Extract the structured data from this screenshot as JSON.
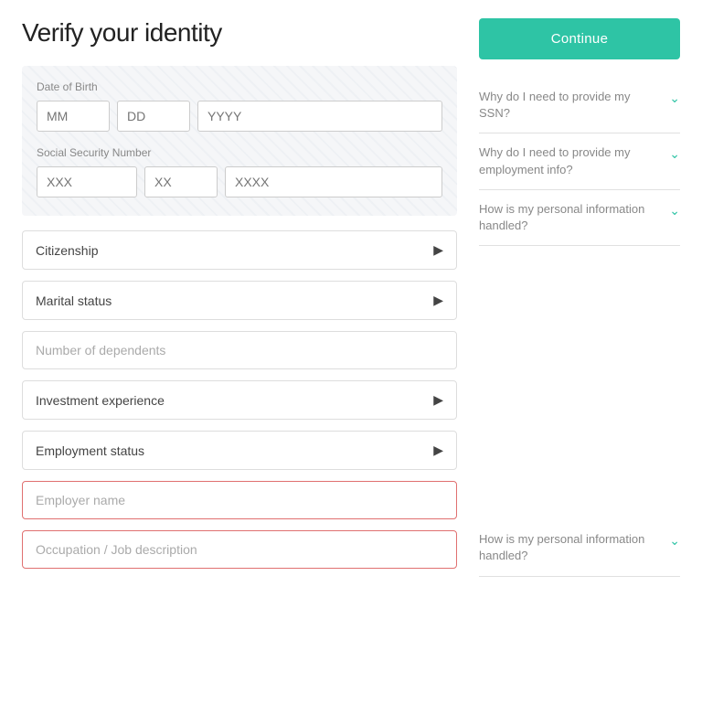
{
  "header": {
    "title": "Verify your identity"
  },
  "form": {
    "dob_label": "Date of Birth",
    "dob_mm_placeholder": "MM",
    "dob_dd_placeholder": "DD",
    "dob_yyyy_placeholder": "YYYY",
    "ssn_label": "Social Security Number",
    "ssn_p1_placeholder": "XXX",
    "ssn_p2_placeholder": "XX",
    "ssn_p3_placeholder": "XXXX",
    "citizenship_label": "Citizenship",
    "marital_label": "Marital status",
    "dependents_placeholder": "Number of dependents",
    "investment_label": "Investment experience",
    "employment_label": "Employment status",
    "employer_placeholder": "Employer name",
    "occupation_placeholder": "Occupation / Job description"
  },
  "sidebar": {
    "continue_label": "Continue",
    "faqs": [
      {
        "id": "faq-ssn",
        "text": "Why do I need to provide my SSN?"
      },
      {
        "id": "faq-employment",
        "text": "Why do I need to provide my employment info?"
      },
      {
        "id": "faq-personal",
        "text": "How is my personal information handled?"
      },
      {
        "id": "faq-personal2",
        "text": "How is my personal information handled?"
      }
    ]
  }
}
